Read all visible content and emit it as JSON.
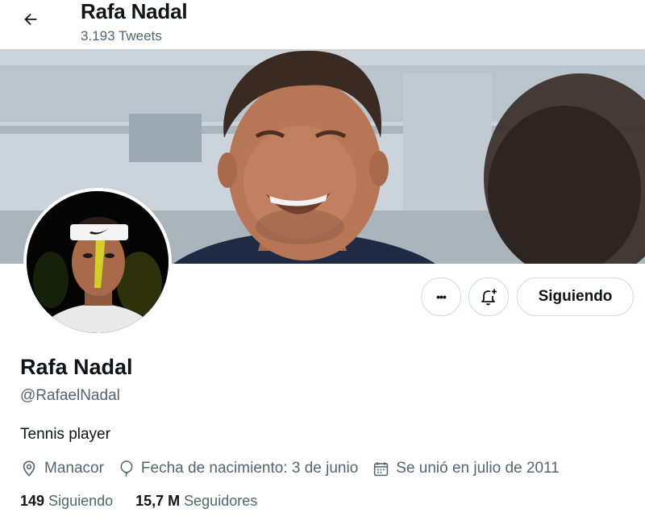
{
  "header": {
    "title": "Rafa Nadal",
    "tweet_count": "3.193 Tweets"
  },
  "profile": {
    "name": "Rafa Nadal",
    "handle": "@RafaelNadal",
    "bio": "Tennis player",
    "location": "Manacor",
    "birthday": "Fecha de nacimiento: 3 de junio",
    "joined": "Se unió en julio de 2011"
  },
  "actions": {
    "more_label": "•••",
    "follow_label": "Siguiendo"
  },
  "stats": {
    "following_count": "149",
    "following_label": "Siguiendo",
    "followers_count": "15,7 M",
    "followers_label": "Seguidores"
  },
  "icons": [
    "back-arrow-icon",
    "more-icon",
    "bell-plus-icon",
    "location-icon",
    "balloon-icon",
    "calendar-icon"
  ],
  "colors": {
    "text": "#0f1419",
    "secondary": "#536471",
    "border": "#cfd9de"
  }
}
